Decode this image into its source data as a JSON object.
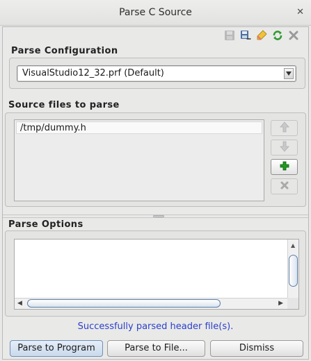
{
  "window": {
    "title": "Parse C Source",
    "close_glyph": "✕"
  },
  "toolbar": {
    "icons": [
      "save-disabled-icon",
      "save-as-icon",
      "clear-icon",
      "refresh-icon",
      "close-icon"
    ]
  },
  "config": {
    "label": "Parse Configuration",
    "selected": "VisualStudio12_32.prf (Default)"
  },
  "source_files": {
    "label": "Source files to parse",
    "files": [
      "/tmp/dummy.h"
    ]
  },
  "options": {
    "label": "Parse Options",
    "text": ""
  },
  "status": {
    "message": "Successfully parsed header file(s)."
  },
  "buttons": {
    "parse_program": "Parse to Program",
    "parse_file": "Parse to File...",
    "dismiss": "Dismiss"
  },
  "colors": {
    "status_text": "#2b3fc9",
    "add_icon": "#1f9a1f"
  }
}
